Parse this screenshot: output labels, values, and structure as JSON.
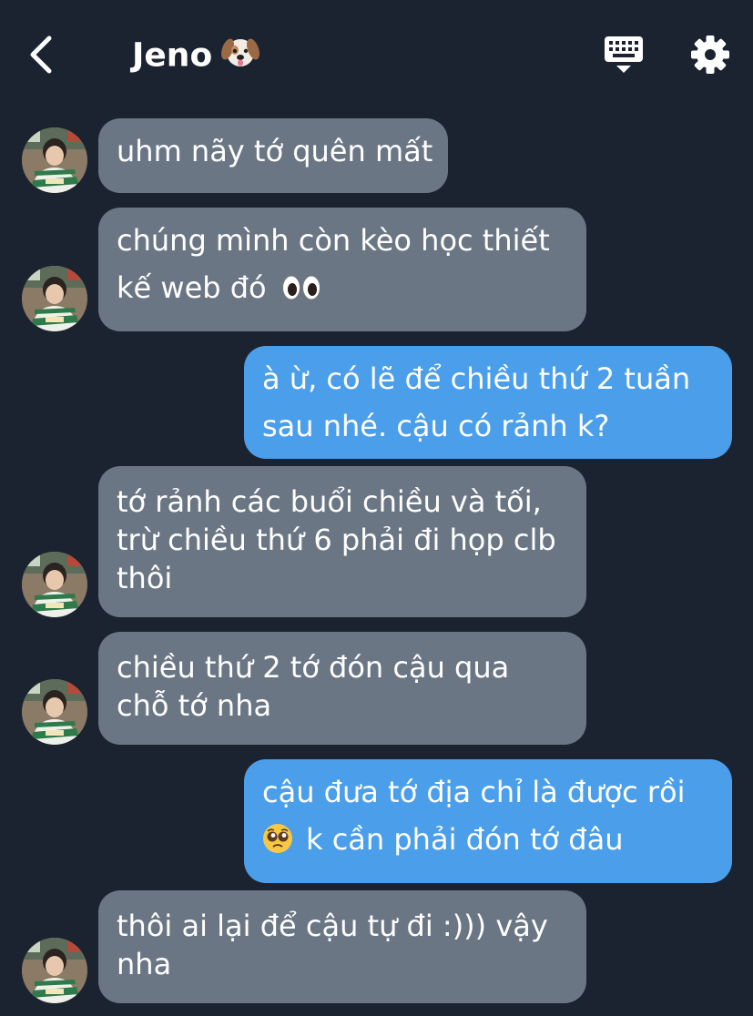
{
  "header": {
    "title": "Jeno",
    "title_emoji": "dog-face-icon",
    "back_icon": "chevron-left-icon",
    "keyboard_icon": "keyboard-icon",
    "settings_icon": "gear-icon"
  },
  "colors": {
    "background": "#1b2330",
    "incoming_bubble": "#6b7685",
    "outgoing_bubble": "#4a9eea"
  },
  "messages": [
    {
      "sender": "Jeno",
      "direction": "incoming",
      "lines": [
        "uhm nãy tớ quên mất"
      ]
    },
    {
      "sender": "Jeno",
      "direction": "incoming",
      "lines": [
        "chúng mình còn kèo học thiết",
        "kế web đó"
      ],
      "emoji": "eyes-emoji"
    },
    {
      "sender": "me",
      "direction": "outgoing",
      "lines": [
        "à ừ, có lẽ để chiều thứ 2 tuần",
        "sau nhé. cậu có rảnh k?"
      ]
    },
    {
      "sender": "Jeno",
      "direction": "incoming",
      "lines": [
        "tớ rảnh các buổi chiều và tối,",
        "trừ chiều thứ 6 phải đi họp clb",
        "thôi"
      ]
    },
    {
      "sender": "Jeno",
      "direction": "incoming",
      "lines": [
        "chiều thứ 2 tớ đón cậu qua",
        "chỗ tớ nha"
      ]
    },
    {
      "sender": "me",
      "direction": "outgoing",
      "lines": [
        "cậu đưa tớ địa chỉ là được rồi",
        "k cần phải đón tớ đâu"
      ],
      "emoji": "pleading-face-emoji"
    },
    {
      "sender": "Jeno",
      "direction": "incoming",
      "lines": [
        "thôi ai lại để cậu tự đi :))) vậy",
        "nha"
      ]
    }
  ]
}
